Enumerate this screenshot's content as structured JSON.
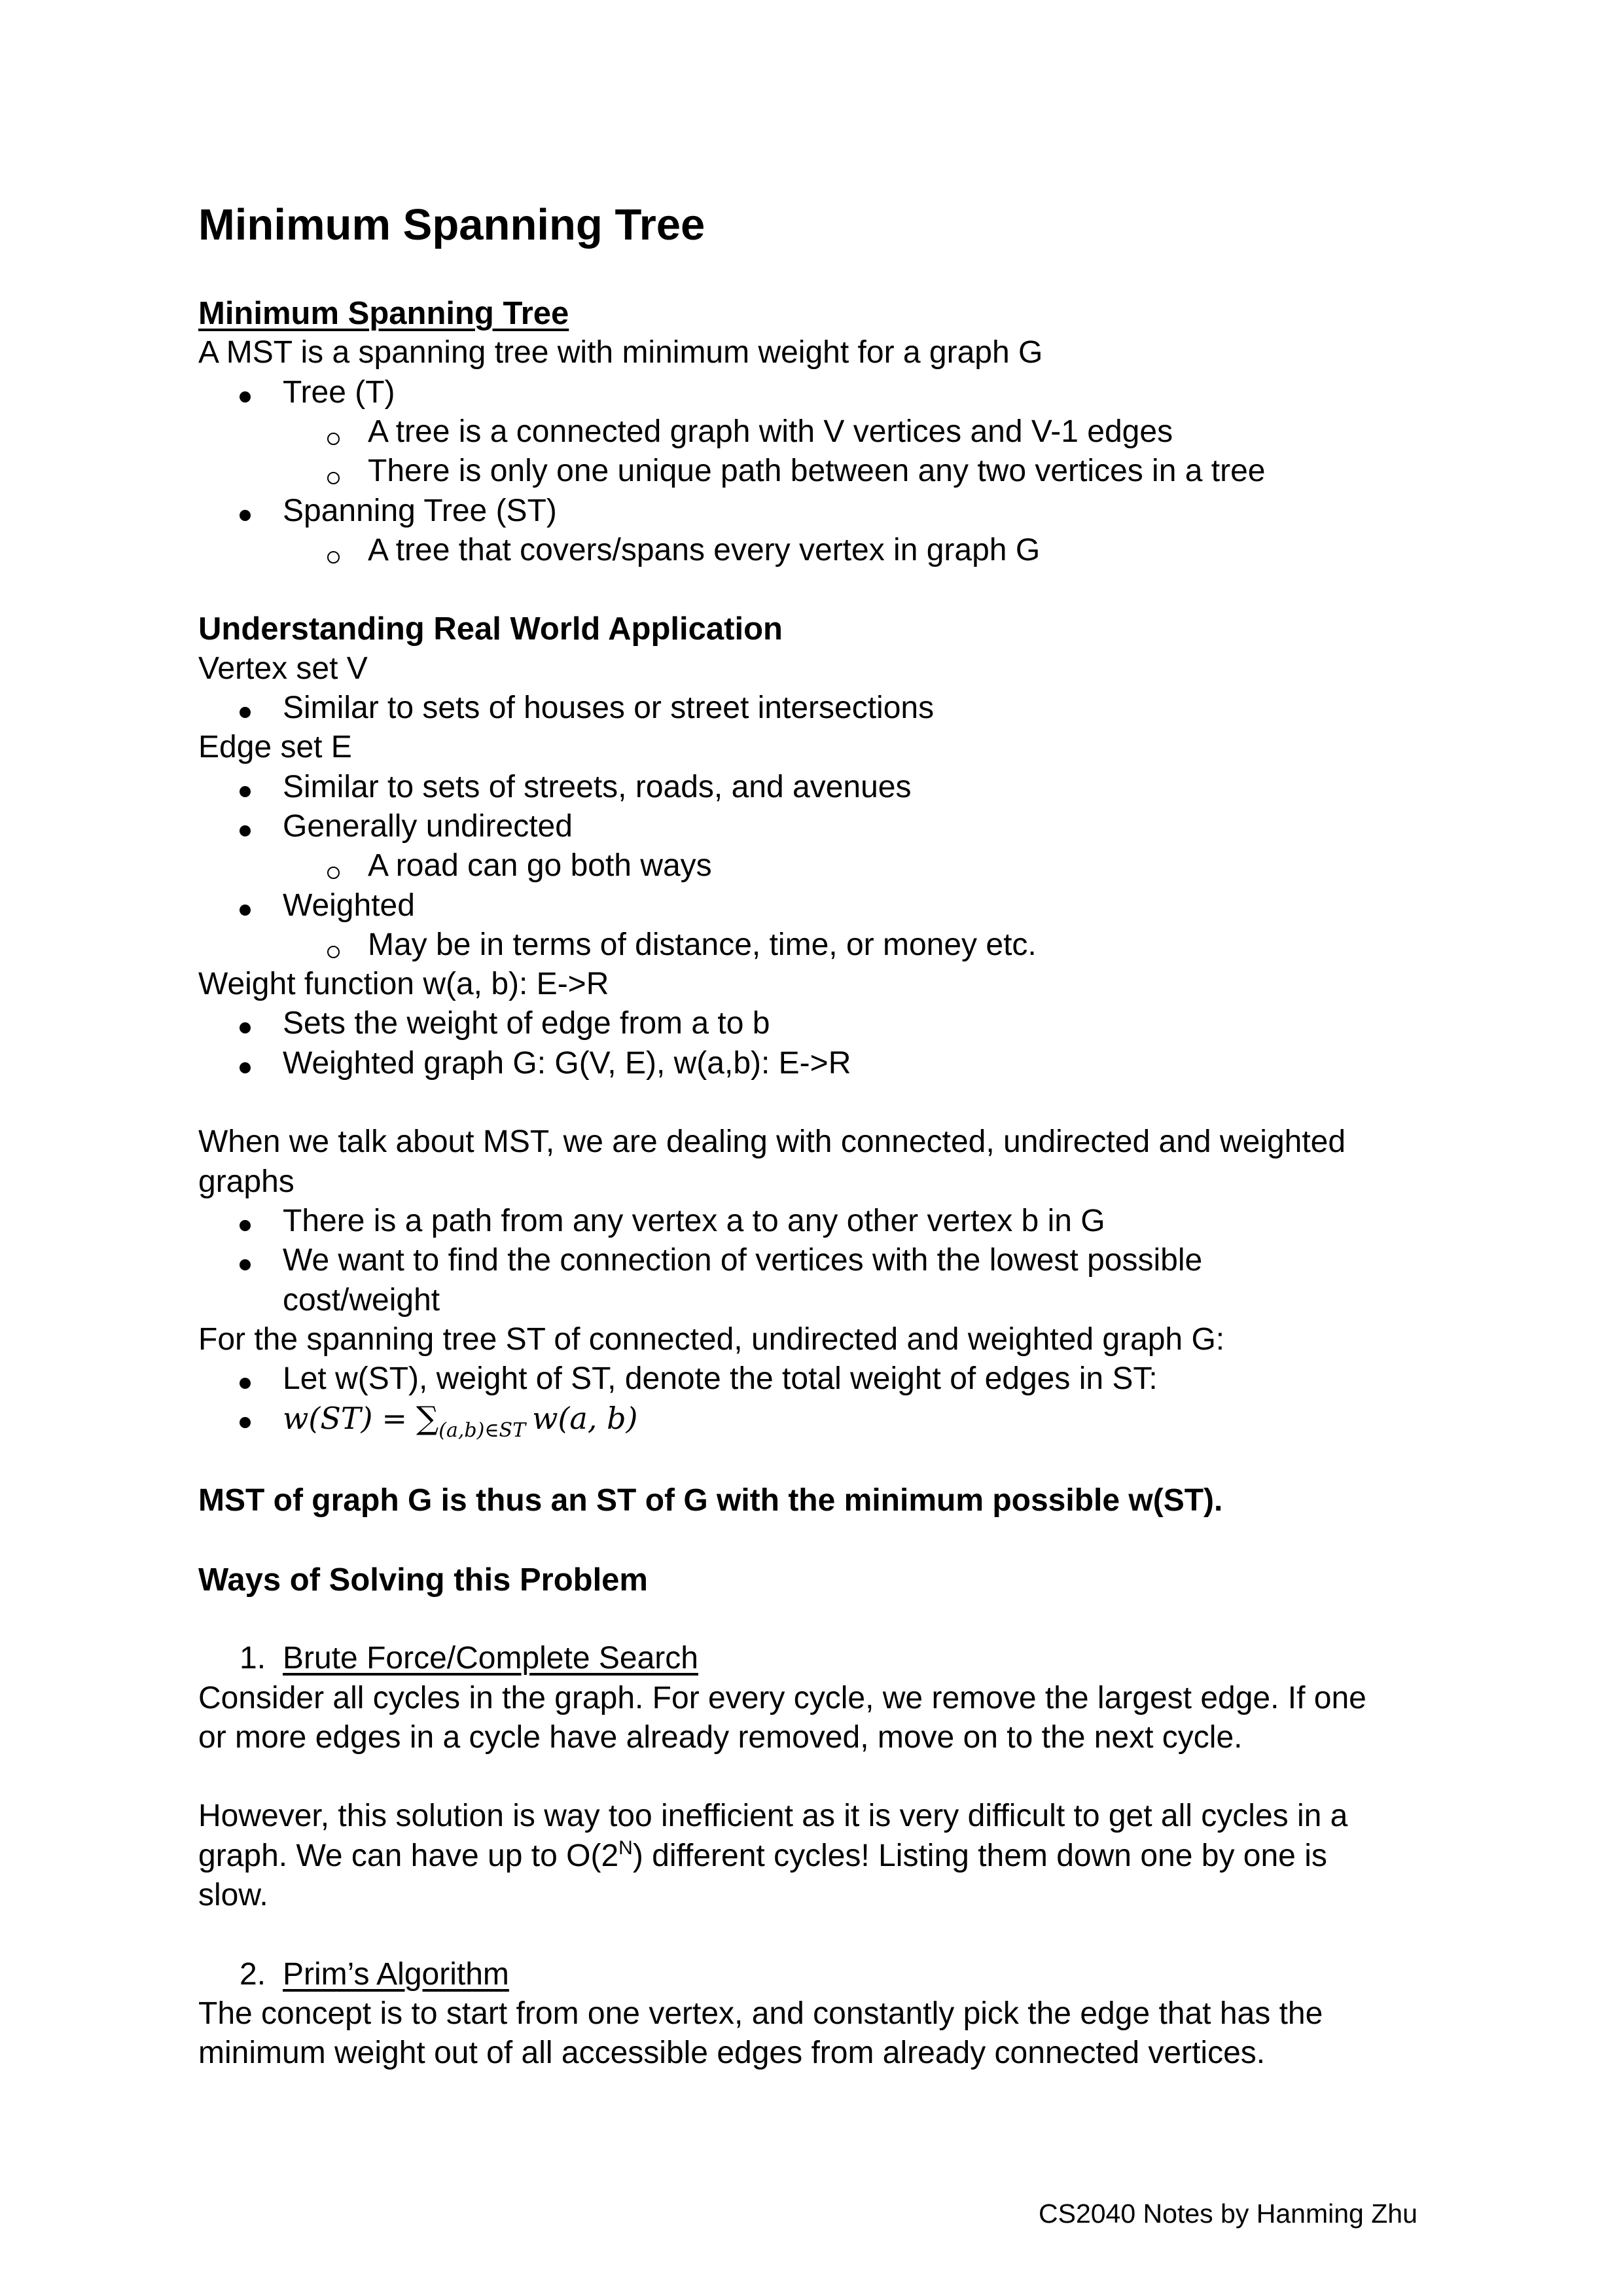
{
  "document": {
    "title": "Minimum Spanning Tree",
    "footer": "CS2040 Notes by Hanming Zhu"
  },
  "lines": [
    {
      "kind": "heading-underline",
      "level": 0,
      "text": "Minimum Spanning Tree"
    },
    {
      "kind": "text",
      "level": 0,
      "text": "A MST is a spanning tree with minimum weight for a graph G"
    },
    {
      "kind": "bullet",
      "level": 1,
      "text": "Tree (T)"
    },
    {
      "kind": "subbullet",
      "level": 2,
      "text": "A tree is a connected graph with V vertices and V-1 edges"
    },
    {
      "kind": "subbullet",
      "level": 2,
      "text": "There is only one unique path between any two vertices in a tree"
    },
    {
      "kind": "bullet",
      "level": 1,
      "text": "Spanning Tree (ST)"
    },
    {
      "kind": "subbullet",
      "level": 2,
      "text": "A tree that covers/spans every vertex in graph G"
    },
    {
      "kind": "blank"
    },
    {
      "kind": "heading",
      "level": 0,
      "text": "Understanding Real World Application"
    },
    {
      "kind": "text",
      "level": 0,
      "text": "Vertex set V"
    },
    {
      "kind": "bullet",
      "level": 1,
      "text": "Similar to sets of houses or street intersections"
    },
    {
      "kind": "text",
      "level": 0,
      "text": "Edge set E"
    },
    {
      "kind": "bullet",
      "level": 1,
      "text": "Similar to sets of streets, roads, and avenues"
    },
    {
      "kind": "bullet",
      "level": 1,
      "text": "Generally undirected"
    },
    {
      "kind": "subbullet",
      "level": 2,
      "text": "A road can go both ways"
    },
    {
      "kind": "bullet",
      "level": 1,
      "text": "Weighted"
    },
    {
      "kind": "subbullet",
      "level": 2,
      "text": "May be in terms of distance, time, or money etc."
    },
    {
      "kind": "text",
      "level": 0,
      "text": "Weight function w(a, b): E->R"
    },
    {
      "kind": "bullet",
      "level": 1,
      "text": "Sets the weight of edge from a to b"
    },
    {
      "kind": "bullet",
      "level": 1,
      "text": "Weighted graph G: G(V, E), w(a,b):  E->R"
    },
    {
      "kind": "blank"
    },
    {
      "kind": "text",
      "level": 0,
      "text": "When we talk about MST, we are dealing with connected, undirected and weighted"
    },
    {
      "kind": "text",
      "level": 0,
      "text": "graphs"
    },
    {
      "kind": "bullet",
      "level": 1,
      "text": "There is a path from any vertex a to any other vertex b in G"
    },
    {
      "kind": "bullet",
      "level": 1,
      "text": "We want to find the connection of vertices with the lowest possible"
    },
    {
      "kind": "continuation",
      "level": 1,
      "text": "cost/weight"
    },
    {
      "kind": "text",
      "level": 0,
      "text": "For the spanning tree ST of connected, undirected and weighted graph G:"
    },
    {
      "kind": "bullet",
      "level": 1,
      "text": "Let w(ST), weight of ST, denote the total weight of edges in ST:"
    },
    {
      "kind": "formula",
      "level": 1,
      "formula": {
        "lhs": "w(ST)",
        "eq": "=",
        "sigma": "∑",
        "subscript": "(a,b)∈ST",
        "rhs": "w(a, b)"
      }
    },
    {
      "kind": "blank"
    },
    {
      "kind": "bold",
      "level": 0,
      "text": "MST of graph G is thus an ST of G with the minimum possible w(ST)."
    },
    {
      "kind": "blank"
    },
    {
      "kind": "heading",
      "level": 0,
      "text": "Ways of Solving this Problem"
    },
    {
      "kind": "blank"
    },
    {
      "kind": "numbered",
      "level": 1,
      "number": "1.",
      "text": "Brute Force/Complete Search"
    },
    {
      "kind": "text",
      "level": 0,
      "text": "Consider all cycles in the graph. For every cycle, we remove the largest edge. If one"
    },
    {
      "kind": "text",
      "level": 0,
      "text": "or more edges in a cycle have already removed, move on to the next cycle."
    },
    {
      "kind": "blank"
    },
    {
      "kind": "text",
      "level": 0,
      "text": "However, this solution is way too inefficient as it is very difficult to get all cycles in a"
    },
    {
      "kind": "exponent",
      "level": 0,
      "before": "graph. We can have up to O(2",
      "exp": "N",
      "after": ") different cycles! Listing them down one by one is"
    },
    {
      "kind": "text",
      "level": 0,
      "text": "slow."
    },
    {
      "kind": "blank"
    },
    {
      "kind": "numbered",
      "level": 1,
      "number": "2.",
      "text": "Prim’s Algorithm"
    },
    {
      "kind": "text",
      "level": 0,
      "text": "The concept is to start from one vertex, and constantly pick the edge that has the"
    },
    {
      "kind": "text",
      "level": 0,
      "text": "minimum weight out of all accessible edges from already connected vertices."
    }
  ]
}
